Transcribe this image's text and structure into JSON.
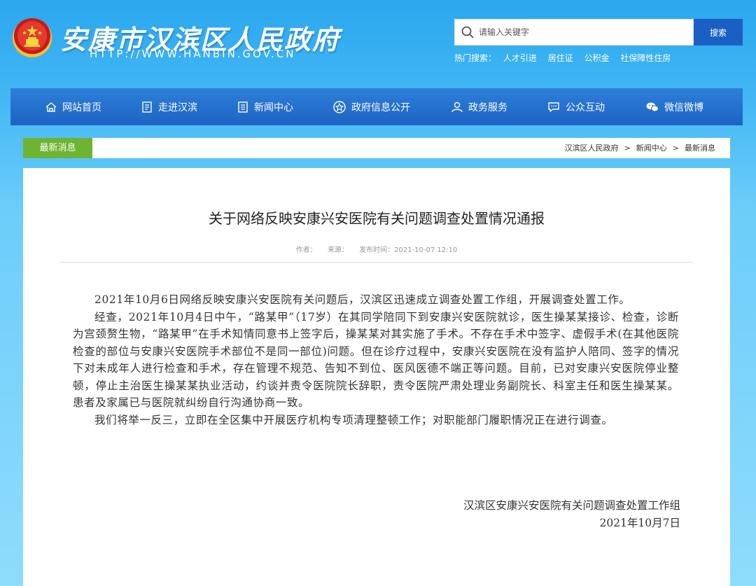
{
  "header": {
    "site_title": "安康市汉滨区人民政府",
    "site_url": "HTTP://WWW.HANBIN.GOV.CN",
    "search_placeholder": "请输入关键字",
    "search_button": "搜索",
    "hot_label": "热门搜索：",
    "hot_items": [
      "人才引进",
      "居住证",
      "公积金",
      "社保障性住房"
    ]
  },
  "nav": {
    "items": [
      {
        "label": "网站首页",
        "icon": "home-icon"
      },
      {
        "label": "走进汉滨",
        "icon": "document-icon"
      },
      {
        "label": "新闻中心",
        "icon": "news-icon"
      },
      {
        "label": "政府信息公开",
        "icon": "star-badge-icon"
      },
      {
        "label": "政务服务",
        "icon": "user-icon"
      },
      {
        "label": "公众互动",
        "icon": "chat-icon"
      },
      {
        "label": "微信微博",
        "icon": "wechat-icon"
      }
    ]
  },
  "breadcrumb": {
    "tag": "最新消息",
    "items": [
      "汉滨区人民政府",
      "新闻中心",
      "最新消息"
    ],
    "separator": ">"
  },
  "article": {
    "title": "关于网络反映安康兴安医院有关问题调查处置情况通报",
    "author_label": "作者：",
    "source_label": "来源：",
    "date_label": "发布时间：2021-10-07 12:10",
    "paragraphs": [
      "2021年10月6日网络反映安康兴安医院有关问题后，汉滨区迅速成立调查处置工作组，开展调查处置工作。",
      "经查，2021年10月4日中午，“路某甲”（17岁）在其同学陪同下到安康兴安医院就诊，医生操某某接诊、检查，诊断为宫颈赘生物，“路某甲”在手术知情同意书上签字后，操某某对其实施了手术。不存在手术中签字、虚假手术(在其他医院检查的部位与安康兴安医院手术部位不是同一部位)问题。但在诊疗过程中，安康兴安医院在没有监护人陪同、签字的情况下对未成年人进行检查和手术，存在管理不规范、告知不到位、医风医德不端正等问题。目前，已对安康兴安医院停业整顿，停止主治医生操某某执业活动，约谈并责令医院院长辞职，责令医院严肃处理业务副院长、科室主任和医生操某某。患者及家属已与医院就纠纷自行沟通协商一致。",
      "我们将举一反三，立即在全区集中开展医疗机构专项清理整顿工作；对职能部门履职情况正在进行调查。"
    ],
    "signature": "汉滨区安康兴安医院有关问题调查处置工作组",
    "sign_date": "2021年10月7日"
  },
  "colors": {
    "background": "#3fb5f3",
    "nav": "#1d63c3",
    "search_button": "#1a5fc4",
    "tag": "#6cb431"
  }
}
